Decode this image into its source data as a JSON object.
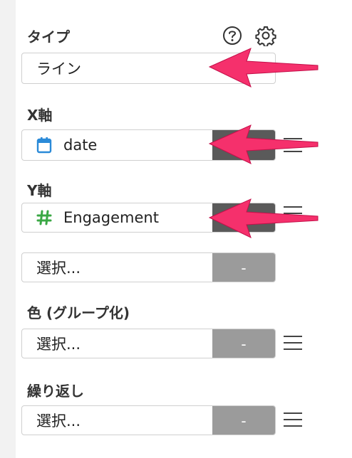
{
  "type_section": {
    "label": "タイプ",
    "value": "ライン"
  },
  "x_axis": {
    "label": "X軸",
    "field": "date",
    "icon": "calendar-icon"
  },
  "y_axis": {
    "label": "Y軸",
    "field": "Engagement",
    "icon": "hash-icon"
  },
  "extra_select": {
    "placeholder": "選択...",
    "button": "-"
  },
  "color_group": {
    "label": "色 (グループ化)",
    "placeholder": "選択...",
    "button": "-"
  },
  "repeat": {
    "label": "繰り返し",
    "placeholder": "選択...",
    "button": "-"
  },
  "colors": {
    "arrow": "#f5306c",
    "calendar": "#2a8ad8",
    "hash": "#3aa845",
    "dark_button": "#5a5a5a",
    "grey_button": "#9b9b9b"
  }
}
